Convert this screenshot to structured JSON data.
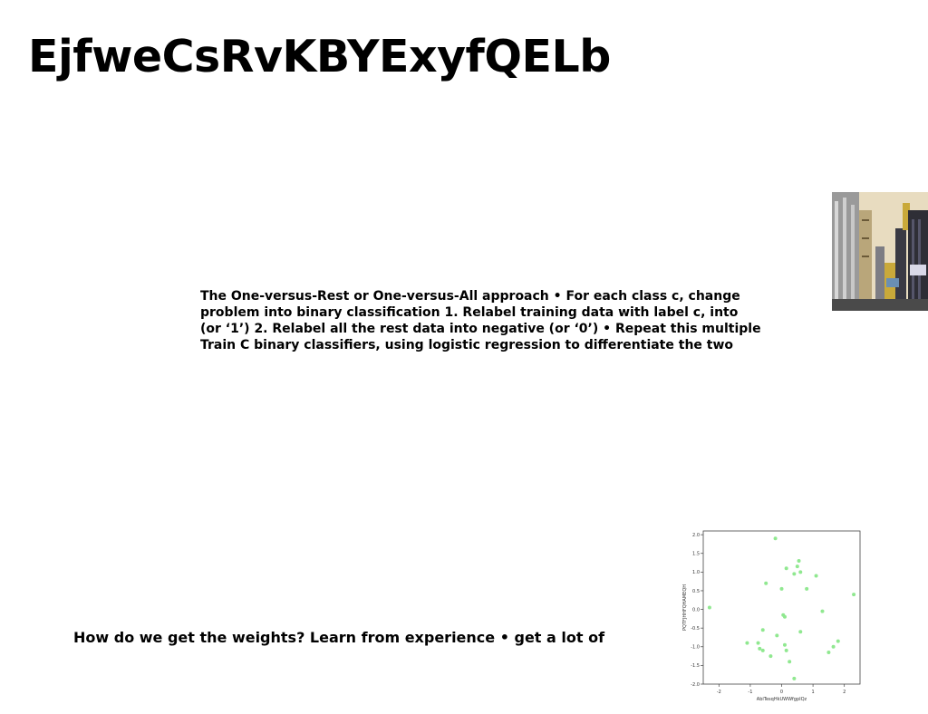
{
  "title": "EjfweCsRvKBYExyfQELb",
  "body": {
    "lines": [
      "The One-versus-Rest or One-versus-All approach • For each class c, change",
      "problem into binary classification 1. Relabel training data with label c, into",
      "(or ‘1’) 2. Relabel all the rest data into negative (or ‘0’) • Repeat this multiple",
      "Train C binary classifiers, using logistic regression to differentiate the two"
    ]
  },
  "caption": "How do we get the weights? Learn from experience • get a lot of",
  "image": {
    "subject": "city street with tall buildings",
    "colors": {
      "sky": "#e8dcc0",
      "building_gray": "#8a8a8a",
      "building_dark": "#2e2e36",
      "accent_yellow": "#c9a93a"
    }
  },
  "chart_data": {
    "type": "scatter",
    "xlabel": "AbiTesqHkUWWfgpIQz",
    "ylabel": "PQTFJHHFQHAMEQH",
    "xlim": [
      -2.5,
      2.5
    ],
    "ylim": [
      -2.0,
      2.1
    ],
    "xticks": [
      -2,
      -1,
      0,
      1,
      2
    ],
    "yticks": [
      -2.0,
      -1.5,
      -1.0,
      -0.5,
      0.0,
      0.5,
      1.0,
      1.5,
      2.0
    ],
    "marker_color": "#90e890",
    "points": [
      {
        "x": -2.3,
        "y": 0.05
      },
      {
        "x": -0.2,
        "y": 1.9
      },
      {
        "x": -0.5,
        "y": 0.7
      },
      {
        "x": 0.0,
        "y": 0.55
      },
      {
        "x": 0.15,
        "y": 1.1
      },
      {
        "x": 0.4,
        "y": 0.95
      },
      {
        "x": 0.5,
        "y": 1.15
      },
      {
        "x": 0.55,
        "y": 1.3
      },
      {
        "x": 0.6,
        "y": 1.0
      },
      {
        "x": 0.8,
        "y": 0.55
      },
      {
        "x": 1.1,
        "y": 0.9
      },
      {
        "x": 1.3,
        "y": -0.05
      },
      {
        "x": 2.3,
        "y": 0.4
      },
      {
        "x": 0.05,
        "y": -0.15
      },
      {
        "x": 0.1,
        "y": -0.2
      },
      {
        "x": -0.6,
        "y": -0.55
      },
      {
        "x": -0.15,
        "y": -0.7
      },
      {
        "x": 0.6,
        "y": -0.6
      },
      {
        "x": -1.1,
        "y": -0.9
      },
      {
        "x": -0.75,
        "y": -0.9
      },
      {
        "x": -0.7,
        "y": -1.05
      },
      {
        "x": -0.6,
        "y": -1.1
      },
      {
        "x": 0.1,
        "y": -0.95
      },
      {
        "x": 0.15,
        "y": -1.1
      },
      {
        "x": -0.35,
        "y": -1.25
      },
      {
        "x": 0.25,
        "y": -1.4
      },
      {
        "x": 0.4,
        "y": -1.85
      },
      {
        "x": 1.5,
        "y": -1.15
      },
      {
        "x": 1.65,
        "y": -1.0
      },
      {
        "x": 1.8,
        "y": -0.85
      }
    ]
  }
}
